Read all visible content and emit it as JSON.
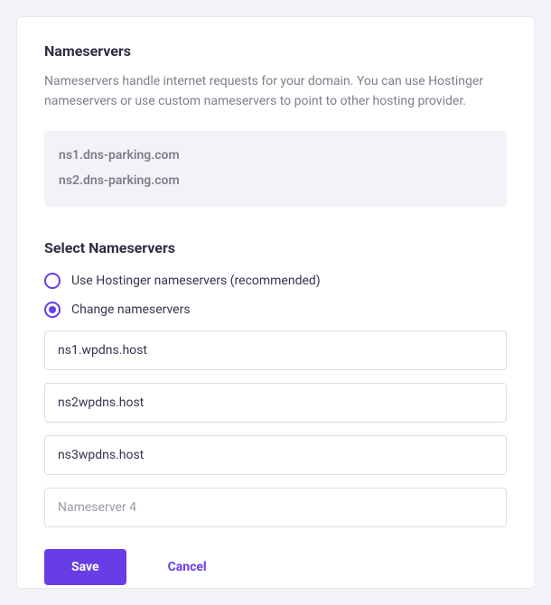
{
  "section": {
    "title": "Nameservers",
    "description": "Nameservers handle internet requests for your domain. You can use Hostinger nameservers or use custom nameservers to point to other hosting provider."
  },
  "current_ns": [
    "ns1.dns-parking.com",
    "ns2.dns-parking.com"
  ],
  "select": {
    "title": "Select Nameservers",
    "option_hostinger": "Use Hostinger nameservers (recommended)",
    "option_change": "Change nameservers",
    "selected": "change"
  },
  "inputs": {
    "ns1": "ns1.wpdns.host",
    "ns2": "ns2wpdns.host",
    "ns3": "ns3wpdns.host",
    "ns4": "",
    "ns4_placeholder": "Nameserver 4"
  },
  "actions": {
    "save": "Save",
    "cancel": "Cancel"
  }
}
